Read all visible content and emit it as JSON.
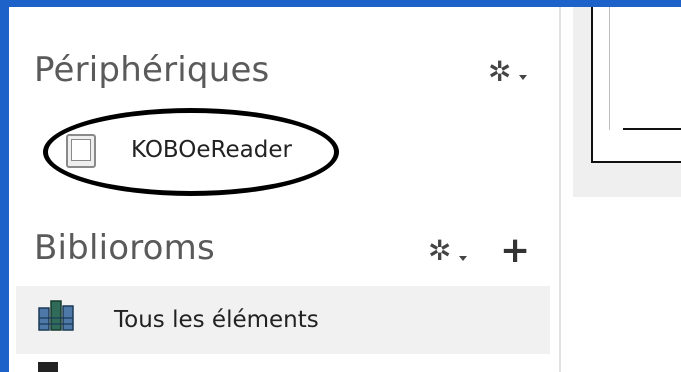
{
  "sidebar": {
    "sections": [
      {
        "title": "Périphériques",
        "actions": [
          "gear-settings"
        ]
      },
      {
        "title": "Biblioroms",
        "actions": [
          "gear-settings",
          "add"
        ]
      }
    ],
    "devices": [
      {
        "label": "KOBOeReader",
        "icon": "ereader-icon"
      }
    ],
    "library_items": [
      {
        "label": "Tous les éléments",
        "icon": "library-icon"
      }
    ]
  },
  "colors": {
    "accent": "#1d62c8",
    "selected_row": "#f1f1f1",
    "text_muted": "#5a5a5a",
    "text": "#222222"
  }
}
